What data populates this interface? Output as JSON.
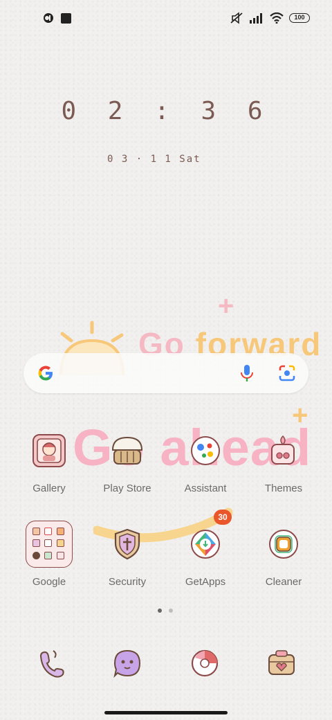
{
  "status_bar": {
    "battery": "100",
    "icons": [
      "notification-icon",
      "square-app-icon",
      "mute-icon",
      "signal-icon",
      "wifi-icon",
      "battery-icon"
    ]
  },
  "lockscreen_clock": {
    "time": "0 2 : 3 6",
    "date": "0 3 · 1 1  Sat"
  },
  "wallpaper": {
    "text_top_1": "Go",
    "text_top_2": "forward",
    "text_bottom": "Go ahead",
    "colors": {
      "pink": "#f5b9c4",
      "yellow": "#f7c77a"
    }
  },
  "search_bar": {
    "icons": [
      "google-logo-icon",
      "microphone-icon",
      "lens-camera-icon"
    ]
  },
  "apps_row1": [
    {
      "label": "Gallery",
      "icon": "gallery-icon"
    },
    {
      "label": "Play Store",
      "icon": "play-store-icon"
    },
    {
      "label": "Assistant",
      "icon": "assistant-icon"
    },
    {
      "label": "Themes",
      "icon": "themes-icon"
    }
  ],
  "apps_row2": [
    {
      "label": "Google",
      "icon": "google-folder-icon"
    },
    {
      "label": "Security",
      "icon": "security-icon"
    },
    {
      "label": "GetApps",
      "icon": "getapps-icon",
      "badge": "30"
    },
    {
      "label": "Cleaner",
      "icon": "cleaner-icon"
    }
  ],
  "page_indicator": {
    "count": 2,
    "active": 0
  },
  "dock": [
    {
      "icon": "phone-icon"
    },
    {
      "icon": "messages-icon"
    },
    {
      "icon": "browser-icon"
    },
    {
      "icon": "camera-icon"
    }
  ],
  "colors": {
    "badge": "#e8562a",
    "clock": "#7a5a52"
  }
}
